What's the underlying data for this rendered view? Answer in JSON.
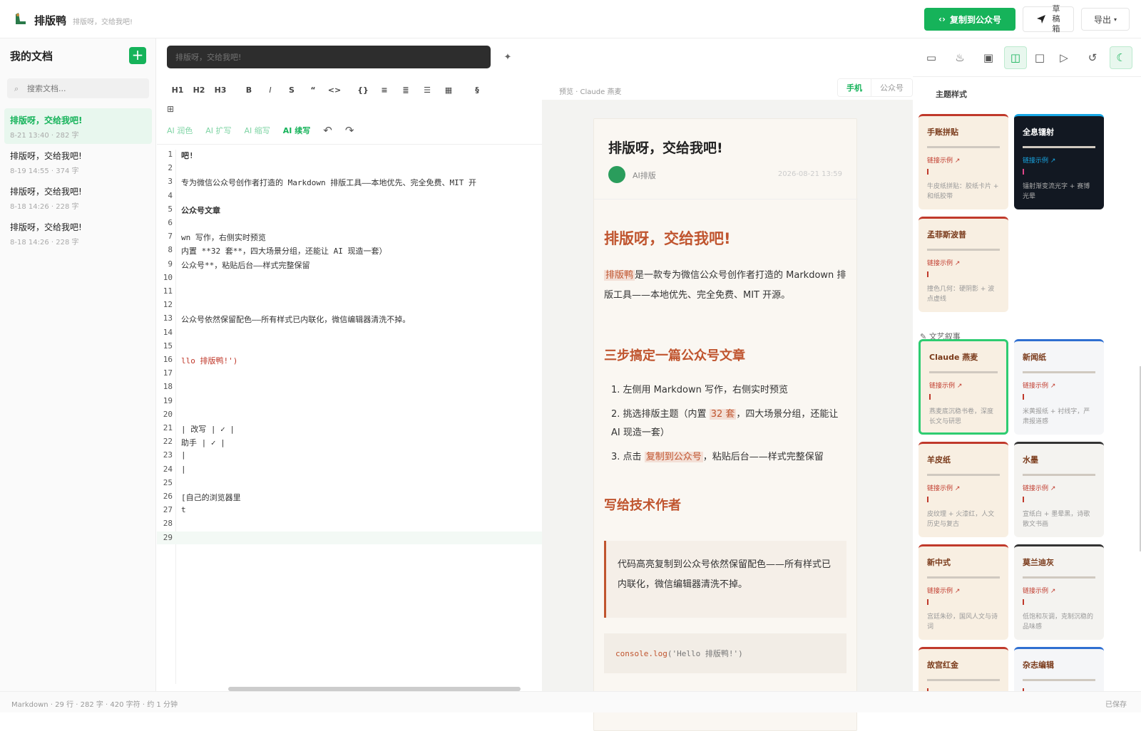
{
  "app": {
    "title": "排版鸭",
    "slogan": "排版呀，交给我吧!"
  },
  "topbar": {
    "copy_label": "复制到公众号",
    "draft_label": "草稿箱",
    "export_label": "导出"
  },
  "sidebar": {
    "title": "我的文档",
    "search_placeholder": "搜索文档...",
    "docs": [
      {
        "title": "排版呀，交给我吧!",
        "meta": "8-21 13:40 · 282 字"
      },
      {
        "title": "排版呀，交给我吧!",
        "meta": "8-19 14:55 · 374 字"
      },
      {
        "title": "排版呀，交给我吧!",
        "meta": "8-18 14:26 · 228 字"
      },
      {
        "title": "排版呀，交给我吧!",
        "meta": "8-18 14:26 · 228 字"
      }
    ]
  },
  "editor": {
    "prompt_placeholder": "排版呀，交给我吧!",
    "toolbar": [
      "H1",
      "H2",
      "H3",
      "B",
      "I",
      "S",
      "“",
      "<>",
      "{}",
      "≡",
      "≣",
      "☰",
      "▦",
      "§"
    ],
    "toolbar2": "⊞",
    "ai_buttons": [
      "AI 润色",
      "AI 扩写",
      "AI 缩写",
      "AI 续写"
    ],
    "lines": [
      {
        "n": "1",
        "t": "吧!",
        "s": "b"
      },
      {
        "n": "2",
        "t": ""
      },
      {
        "n": "3",
        "t": "专为微信公众号创作者打造的 Markdown 排版工具——本地优先、完全免费、MIT 开"
      },
      {
        "n": "4",
        "t": ""
      },
      {
        "n": "5",
        "t": "公众号文章",
        "s": "b"
      },
      {
        "n": "6",
        "t": ""
      },
      {
        "n": "7",
        "t": "wn 写作，右侧实时预览"
      },
      {
        "n": "8",
        "t": "内置 **32 套**，四大场景分组，还能让 AI 现造一套）"
      },
      {
        "n": "9",
        "t": "公众号**，粘贴后台——样式完整保留"
      },
      {
        "n": "10",
        "t": ""
      },
      {
        "n": "11",
        "t": ""
      },
      {
        "n": "12",
        "t": ""
      },
      {
        "n": "13",
        "t": "公众号依然保留配色——所有样式已内联化，微信编辑器清洗不掉。"
      },
      {
        "n": "14",
        "t": ""
      },
      {
        "n": "15",
        "t": ""
      },
      {
        "n": "16",
        "t": "llo 排版鸭!')",
        "s": "str"
      },
      {
        "n": "17",
        "t": ""
      },
      {
        "n": "18",
        "t": ""
      },
      {
        "n": "19",
        "t": ""
      },
      {
        "n": "20",
        "t": ""
      },
      {
        "n": "21",
        "t": "| 改写 | ✓ |",
        "chk": true
      },
      {
        "n": "22",
        "t": "助手 | ✓ |",
        "chk": true
      },
      {
        "n": "23",
        "t": "|"
      },
      {
        "n": "24",
        "t": "|"
      },
      {
        "n": "25",
        "t": ""
      },
      {
        "n": "26",
        "t": "[自己的浏览器里"
      },
      {
        "n": "27",
        "t": "t"
      },
      {
        "n": "28",
        "t": ""
      },
      {
        "n": "29",
        "t": ""
      }
    ]
  },
  "preview": {
    "hint": "预览 · Claude 燕麦",
    "tabs": [
      "手机",
      "公众号"
    ],
    "title": "排版呀，交给我吧!",
    "author": "AI排版",
    "date": "2026-08-21 13:59",
    "h1": "排版呀，交给我吧!",
    "para_hl": "排版鸭",
    "para": "是一款专为微信公众号创作者打造的 Markdown 排版工具——本地优先、完全免费、MIT 开源。",
    "h2_a": "三步搞定一篇公众号文章",
    "steps": [
      {
        "n": "1.",
        "a": "左侧用 Markdown 写作，右侧实时预览",
        "hl": "",
        "b": ""
      },
      {
        "n": "2.",
        "a": "挑选排版主题（内置 ",
        "hl": "32 套",
        "b": "，四大场景分组，还能让 AI 现造一套）"
      },
      {
        "n": "3.",
        "a": "点击 ",
        "hl": "复制到公众号",
        "b": "，粘贴后台——样式完整保留"
      }
    ],
    "h2_b": "写给技术作者",
    "quote": "代码高亮复制到公众号依然保留配色——所有样式已内联化，微信编辑器清洗不掉。",
    "code_fn": "console.log",
    "code_arg": "('Hello 排版鸭!')"
  },
  "themes": {
    "heading": "主题样式",
    "category": "文艺叙事",
    "cards": [
      {
        "name": "手账拼贴",
        "link": "链接示例 ↗",
        "desc": "牛皮纸拼贴：胶纸卡片 + 和纸胶带",
        "style": "light",
        "col": 0,
        "row": 0
      },
      {
        "name": "全息镭射",
        "link": "链接示例 ↗",
        "desc": "镭射渐变流光字 + 赛博光晕",
        "style": "dark",
        "col": 1,
        "row": 0
      },
      {
        "name": "孟菲斯波普",
        "link": "链接示例 ↗",
        "desc": "撞色几何：硬阴影 + 波点虚线",
        "style": "light",
        "col": 0,
        "row": 1
      },
      {
        "name": "Claude 燕麦",
        "link": "链接示例 ↗",
        "desc": "燕麦底沉稳书卷，深度长文与研思",
        "style": "sel",
        "col": 0,
        "row": 2
      },
      {
        "name": "新闻纸",
        "link": "链接示例 ↗",
        "desc": "米黄报纸 + 衬线字，严肃报道感",
        "style": "blue",
        "col": 1,
        "row": 2
      },
      {
        "name": "羊皮纸",
        "link": "链接示例 ↗",
        "desc": "皮纹理 + 火漆红，人文历史与复古",
        "style": "light",
        "col": 0,
        "row": 3
      },
      {
        "name": "水墨",
        "link": "链接示例 ↗",
        "desc": "宣纸白 + 墨晕黑，诗歌散文书画",
        "style": "ink",
        "col": 1,
        "row": 3
      },
      {
        "name": "新中式",
        "link": "链接示例 ↗",
        "desc": "宫廷朱砂，国风人文与诗词",
        "style": "light",
        "col": 0,
        "row": 4
      },
      {
        "name": "莫兰迪灰",
        "link": "链接示例 ↗",
        "desc": "低饱和灰调，克制沉稳的品味感",
        "style": "ink",
        "col": 1,
        "row": 4
      },
      {
        "name": "故宫红金",
        "link": "",
        "desc": "",
        "style": "light",
        "col": 0,
        "row": 5
      },
      {
        "name": "杂志编辑",
        "link": "",
        "desc": "",
        "style": "blue",
        "col": 1,
        "row": 5
      }
    ]
  },
  "status": {
    "left": "Markdown · 29 行 · 282 字 · 420 字符 · 约 1 分钟",
    "right": "已保存"
  }
}
